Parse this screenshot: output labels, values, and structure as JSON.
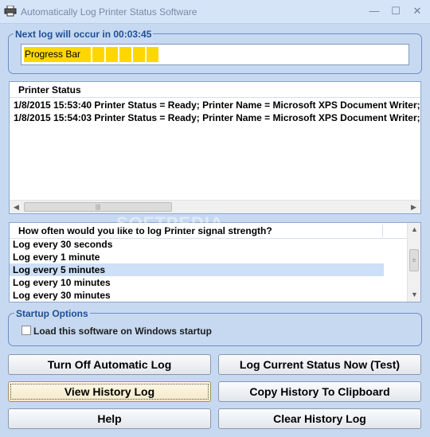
{
  "window": {
    "title": "Automatically Log Printer Status Software",
    "minimize_label": "—",
    "maximize_label": "☐",
    "close_label": "✕"
  },
  "next_log": {
    "label": "Next log will occur in 00:03:45",
    "progress_label": "Progress Bar",
    "progress_blocks": 6
  },
  "printer_status": {
    "column_header": "Printer Status",
    "entries": [
      "1/8/2015 15:53:40 Printer Status = Ready; Printer Name = Microsoft XPS Document Writer;",
      "1/8/2015 15:54:03 Printer Status = Ready; Printer Name = Microsoft XPS Document Writer;"
    ]
  },
  "interval": {
    "column_header": "How often would you like to log Printer signal strength?",
    "options": [
      "Log every 30 seconds",
      "Log every 1 minute",
      "Log every 5 minutes",
      "Log every 10 minutes",
      "Log every 30 minutes"
    ],
    "selected_option": "Log every 5 minutes"
  },
  "startup": {
    "title": "Startup Options",
    "checkbox_label": "Load this software on Windows startup",
    "checked": false
  },
  "buttons": {
    "turn_off": "Turn Off Automatic Log",
    "log_now": "Log Current Status Now (Test)",
    "view_history": "View History Log",
    "copy_history": "Copy History To Clipboard",
    "help": "Help",
    "clear_history": "Clear History Log"
  },
  "watermark": "SOFTPEDIA",
  "colors": {
    "background": "#c7d9f1",
    "group_title": "#1f4f95",
    "progress_fill": "#ffd700",
    "selection": "#cde0f7"
  }
}
